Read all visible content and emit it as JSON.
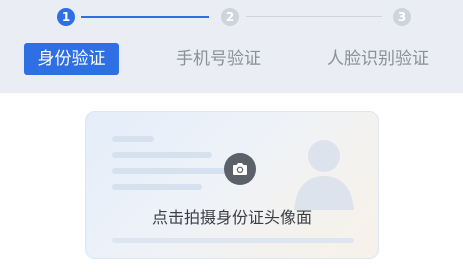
{
  "steps": [
    {
      "number": "1",
      "label": "身份验证"
    },
    {
      "number": "2",
      "label": "手机号验证"
    },
    {
      "number": "3",
      "label": "人脸识别验证"
    }
  ],
  "id_card": {
    "caption": "点击拍摄身份证头像面",
    "icon": "camera-icon"
  },
  "colors": {
    "accent": "#2f6fe4",
    "inactive": "#cfd3db",
    "header_bg": "#eaedf3"
  }
}
